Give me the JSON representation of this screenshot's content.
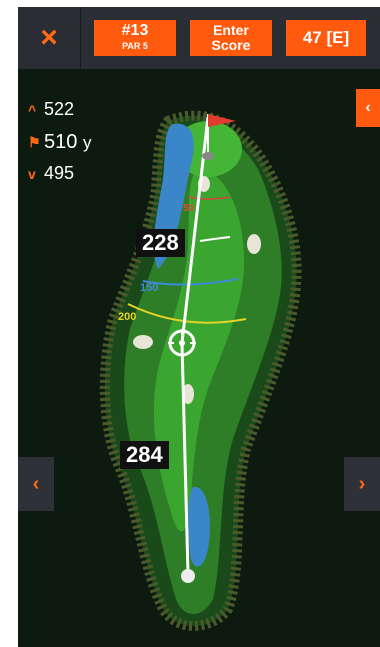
{
  "topbar": {
    "close_label": "×",
    "hole_number": "#13",
    "hole_par": "PAR 5",
    "enter_score_line1": "Enter",
    "enter_score_line2": "Score",
    "total_score": "47 [E]"
  },
  "distances": {
    "back": "522",
    "middle": "510",
    "middle_unit": "y",
    "front": "495"
  },
  "map": {
    "target_to_green": "228",
    "tee_to_target": "284",
    "ring_labels": [
      "50",
      "150",
      "200"
    ]
  },
  "nav": {
    "side_tab": "‹",
    "prev": "‹",
    "next": "›"
  },
  "colors": {
    "accent": "#ff5a0d",
    "fairway": "#3a9a2e",
    "water": "#3a86c8",
    "rough": "#1f5a1c"
  }
}
